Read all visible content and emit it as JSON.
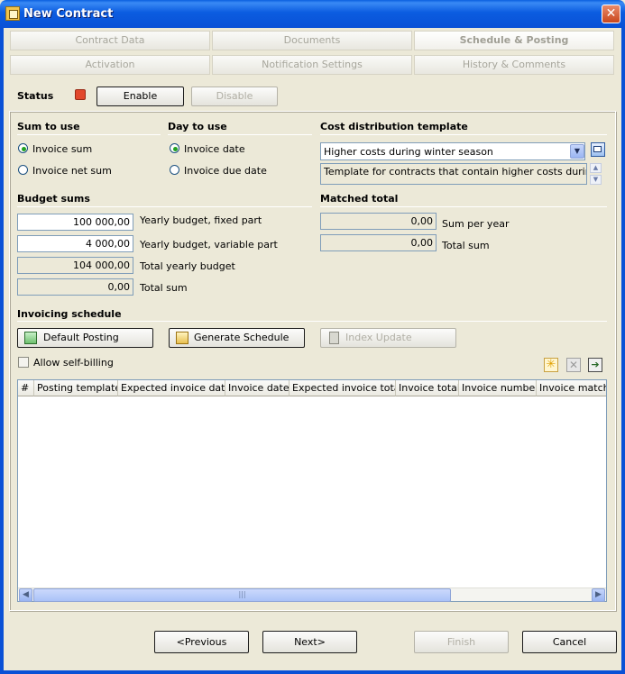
{
  "window": {
    "title": "New Contract",
    "close_glyph": "✕"
  },
  "tabs": {
    "row1": [
      {
        "label": "Contract Data"
      },
      {
        "label": "Documents"
      },
      {
        "label": "Schedule & Posting",
        "active": true
      }
    ],
    "row2": [
      {
        "label": "Activation"
      },
      {
        "label": "Notification Settings"
      },
      {
        "label": "History & Comments"
      }
    ]
  },
  "status": {
    "label": "Status",
    "indicator_color": "#e2482c",
    "enable_label": "Enable",
    "disable_label": "Disable"
  },
  "sum_to_use": {
    "heading": "Sum to use",
    "options": [
      {
        "label": "Invoice sum",
        "selected": true
      },
      {
        "label": "Invoice net sum",
        "selected": false
      }
    ]
  },
  "day_to_use": {
    "heading": "Day to use",
    "options": [
      {
        "label": "Invoice date",
        "selected": true
      },
      {
        "label": "Invoice due date",
        "selected": false
      }
    ]
  },
  "cost_distribution": {
    "heading": "Cost distribution template",
    "selected_template": "Higher costs during winter season",
    "description": "Template for contracts that contain higher costs during the"
  },
  "budget_sums": {
    "heading": "Budget sums",
    "rows": [
      {
        "value": "100 000,00",
        "label": "Yearly budget, fixed part",
        "readonly": false
      },
      {
        "value": "4 000,00",
        "label": "Yearly budget, variable part",
        "readonly": false
      },
      {
        "value": "104 000,00",
        "label": "Total yearly budget",
        "readonly": true
      },
      {
        "value": "0,00",
        "label": "Total sum",
        "readonly": true
      }
    ]
  },
  "matched_total": {
    "heading": "Matched total",
    "rows": [
      {
        "value": "0,00",
        "label": "Sum per year"
      },
      {
        "value": "0,00",
        "label": "Total sum"
      }
    ]
  },
  "invoicing_schedule": {
    "heading": "Invoicing schedule",
    "default_posting_label": "Default Posting",
    "generate_schedule_label": "Generate Schedule",
    "index_update_label": "Index Update",
    "allow_self_billing_label": "Allow self-billing",
    "allow_self_billing_checked": false,
    "columns": [
      "#",
      "Posting template",
      "Expected invoice date",
      "Invoice date",
      "Expected invoice total",
      "Invoice total",
      "Invoice number",
      "Invoice matching"
    ],
    "rows": []
  },
  "footer": {
    "previous_label": "<Previous",
    "next_label": "Next>",
    "finish_label": "Finish",
    "cancel_label": "Cancel"
  }
}
